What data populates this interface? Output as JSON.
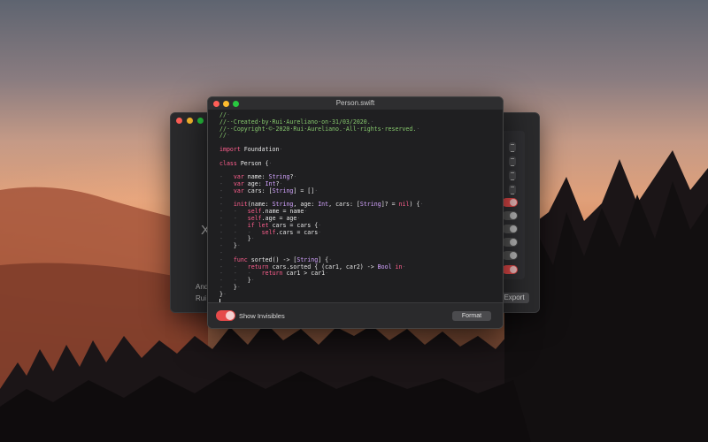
{
  "main_window": {
    "title": "Person.swift",
    "code_lines": [
      [
        {
          "t": "//",
          "c": "cm"
        },
        {
          "t": "·",
          "c": "ws"
        }
      ],
      [
        {
          "t": "//··Created·by·Rui·Aureliano·on·31/03/2020.",
          "c": "cm"
        },
        {
          "t": "·",
          "c": "ws"
        }
      ],
      [
        {
          "t": "//··Copyright·©·2020·Rui·Aureliano.·All·rights·reserved.",
          "c": "cm"
        },
        {
          "t": "·",
          "c": "ws"
        }
      ],
      [
        {
          "t": "//",
          "c": "cm"
        },
        {
          "t": "·",
          "c": "ws"
        }
      ],
      [
        {
          "t": "",
          "c": ""
        }
      ],
      [
        {
          "t": "import",
          "c": "kw"
        },
        {
          "t": " Foundation",
          "c": ""
        },
        {
          "t": "·",
          "c": "ws"
        }
      ],
      [
        {
          "t": "",
          "c": ""
        }
      ],
      [
        {
          "t": "class",
          "c": "kw"
        },
        {
          "t": " Person {",
          "c": ""
        },
        {
          "t": "·",
          "c": "ws"
        }
      ],
      [
        {
          "t": "",
          "c": ""
        }
      ],
      [
        {
          "t": "-   ",
          "c": "ws"
        },
        {
          "t": "var",
          "c": "kw"
        },
        {
          "t": " name: ",
          "c": ""
        },
        {
          "t": "String",
          "c": "ty"
        },
        {
          "t": "?",
          "c": ""
        },
        {
          "t": "·",
          "c": "ws"
        }
      ],
      [
        {
          "t": "-   ",
          "c": "ws"
        },
        {
          "t": "var",
          "c": "kw"
        },
        {
          "t": " age: ",
          "c": ""
        },
        {
          "t": "Int",
          "c": "ty"
        },
        {
          "t": "?",
          "c": ""
        },
        {
          "t": "·",
          "c": "ws"
        }
      ],
      [
        {
          "t": "-   ",
          "c": "ws"
        },
        {
          "t": "var",
          "c": "kw"
        },
        {
          "t": " cars: [",
          "c": ""
        },
        {
          "t": "String",
          "c": "ty"
        },
        {
          "t": "] = []",
          "c": ""
        },
        {
          "t": "·",
          "c": "ws"
        }
      ],
      [
        {
          "t": "-",
          "c": "ws"
        }
      ],
      [
        {
          "t": "-   ",
          "c": "ws"
        },
        {
          "t": "init",
          "c": "kw"
        },
        {
          "t": "(name: ",
          "c": ""
        },
        {
          "t": "String",
          "c": "ty"
        },
        {
          "t": ", age: ",
          "c": ""
        },
        {
          "t": "Int",
          "c": "ty"
        },
        {
          "t": ", cars: [",
          "c": ""
        },
        {
          "t": "String",
          "c": "ty"
        },
        {
          "t": "]? = ",
          "c": ""
        },
        {
          "t": "nil",
          "c": "kw"
        },
        {
          "t": ") {",
          "c": ""
        },
        {
          "t": "·",
          "c": "ws"
        }
      ],
      [
        {
          "t": "-   -   ",
          "c": "ws"
        },
        {
          "t": "self",
          "c": "kw"
        },
        {
          "t": ".name = name",
          "c": ""
        },
        {
          "t": "·",
          "c": "ws"
        }
      ],
      [
        {
          "t": "-   -   ",
          "c": "ws"
        },
        {
          "t": "self",
          "c": "kw"
        },
        {
          "t": ".age = age",
          "c": ""
        },
        {
          "t": "·",
          "c": "ws"
        }
      ],
      [
        {
          "t": "-   -   ",
          "c": "ws"
        },
        {
          "t": "if let",
          "c": "kw"
        },
        {
          "t": " cars = cars {",
          "c": ""
        },
        {
          "t": "·",
          "c": "ws"
        }
      ],
      [
        {
          "t": "-   -   -   ",
          "c": "ws"
        },
        {
          "t": "self",
          "c": "kw"
        },
        {
          "t": ".cars = cars",
          "c": ""
        },
        {
          "t": "·",
          "c": "ws"
        }
      ],
      [
        {
          "t": "-   -   ",
          "c": "ws"
        },
        {
          "t": "}",
          "c": ""
        },
        {
          "t": "·",
          "c": "ws"
        }
      ],
      [
        {
          "t": "-   ",
          "c": "ws"
        },
        {
          "t": "}",
          "c": ""
        },
        {
          "t": "·",
          "c": "ws"
        }
      ],
      [
        {
          "t": "-",
          "c": "ws"
        }
      ],
      [
        {
          "t": "-   ",
          "c": "ws"
        },
        {
          "t": "func",
          "c": "kw"
        },
        {
          "t": " sorted() -> [",
          "c": ""
        },
        {
          "t": "String",
          "c": "ty"
        },
        {
          "t": "] {",
          "c": ""
        },
        {
          "t": "·",
          "c": "ws"
        }
      ],
      [
        {
          "t": "-   -   ",
          "c": "ws"
        },
        {
          "t": "return",
          "c": "kw"
        },
        {
          "t": " cars.sorted { (car1, car2) -> ",
          "c": ""
        },
        {
          "t": "Bool",
          "c": "ty"
        },
        {
          "t": " in",
          "c": "kw"
        },
        {
          "t": "·",
          "c": "ws"
        }
      ],
      [
        {
          "t": "-   -   -   ",
          "c": "ws"
        },
        {
          "t": "return",
          "c": "kw"
        },
        {
          "t": " car1 > car1",
          "c": ""
        },
        {
          "t": "·",
          "c": "ws"
        }
      ],
      [
        {
          "t": "-   -   ",
          "c": "ws"
        },
        {
          "t": "}",
          "c": ""
        },
        {
          "t": "·",
          "c": "ws"
        }
      ],
      [
        {
          "t": "-   ",
          "c": "ws"
        },
        {
          "t": "}",
          "c": ""
        },
        {
          "t": "·",
          "c": "ws"
        }
      ],
      [
        {
          "t": "}",
          "c": ""
        },
        {
          "t": "·",
          "c": "ws"
        }
      ]
    ],
    "show_invisibles_label": "Show Invisibles",
    "show_invisibles_on": true,
    "format_label": "Format"
  },
  "back_window": {
    "x_glyph": "X",
    "text_line1": "And",
    "text_line2": "Rui",
    "export_label": "Export"
  },
  "colors": {
    "close": "#ff5f57",
    "minimize": "#febc2e",
    "zoom": "#28c840",
    "toggle_on": "#e64a4a",
    "comment": "#86c86d",
    "keyword": "#ff5f8e",
    "type": "#d3a3ff"
  }
}
